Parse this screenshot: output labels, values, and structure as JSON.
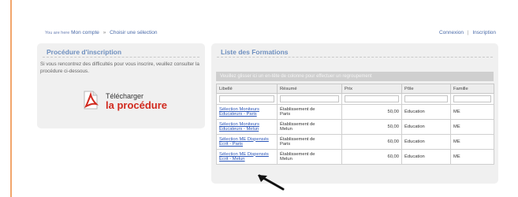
{
  "breadcrumb": {
    "prefix": "You are here",
    "items": [
      "Mon compte",
      "Choisir une sélection"
    ],
    "separator": "»"
  },
  "top_links": {
    "login": "Connexion",
    "separator": "|",
    "register": "Inscription"
  },
  "procedure_panel": {
    "title": "Procédure d'inscription",
    "text": "Si vous rencontrez des difficultés pour vous inscrire, veuillez consulter la procédure ci-dessous.",
    "download_line1": "Télécharger",
    "download_line2": "la procédure",
    "icon": "pdf-icon"
  },
  "formations_panel": {
    "title": "Liste des Formations",
    "group_hint": "Veuillez glisser ici un en-tête de colonne pour effectuer un regroupement",
    "columns": [
      "Libellé",
      "Résumé",
      "Prix",
      "Pôle",
      "Famille"
    ],
    "rows": [
      {
        "libelle_1": "Sélection Moniteurs",
        "libelle_2": "Educateurs - Paris",
        "resume_1": "Établissement de",
        "resume_2": "Paris",
        "prix": "50,00",
        "pole": "Éducation",
        "famille": "ME"
      },
      {
        "libelle_1": "Sélection Moniteurs",
        "libelle_2": "Educateurs - Melun",
        "resume_1": "Établissement de",
        "resume_2": "Melun",
        "prix": "50,00",
        "pole": "Éducation",
        "famille": "ME"
      },
      {
        "libelle_1": "Sélection ME Dispensés",
        "libelle_2": "Ecrit - Paris",
        "resume_1": "Établissement de",
        "resume_2": "Paris",
        "prix": "60,00",
        "pole": "Éducation",
        "famille": "ME"
      },
      {
        "libelle_1": "Sélection ME Dispensés",
        "libelle_2": "Ecrit - Melun",
        "resume_1": "Établissement de",
        "resume_2": "Melun",
        "prix": "60,00",
        "pole": "Éducation",
        "famille": "ME"
      }
    ]
  },
  "colors": {
    "accent_rule": "#f2a56b",
    "panel_title": "#6e8fbf",
    "link": "#2a55b8",
    "download_red": "#d12a1f"
  }
}
